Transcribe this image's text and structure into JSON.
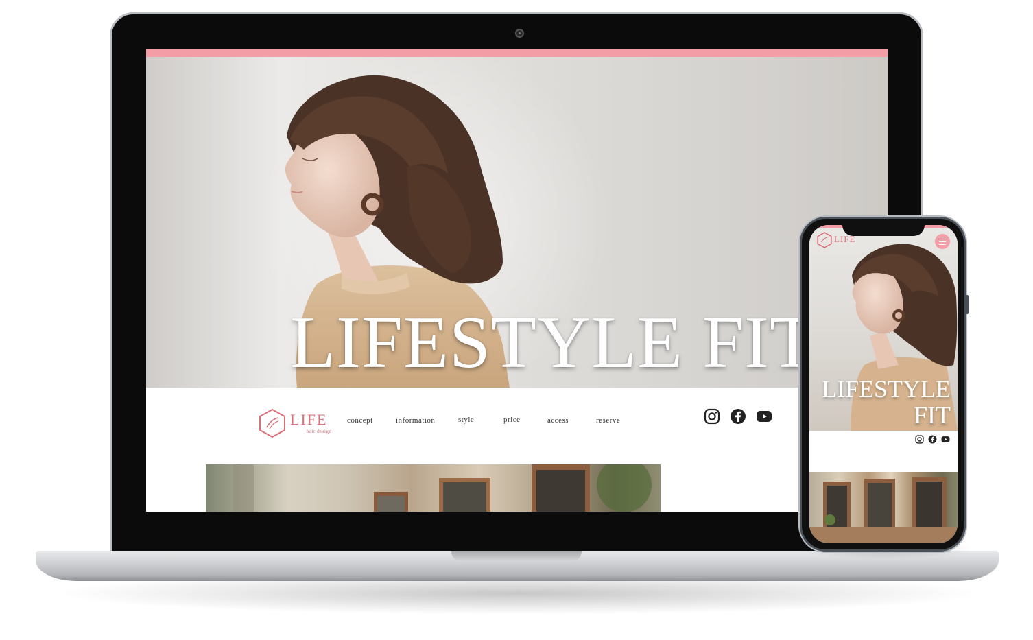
{
  "hero": {
    "title": "LIFESTYLE  FIT"
  },
  "brand": {
    "name": "LIFE",
    "tagline": "hair design",
    "accent_color": "#f39ea7",
    "logo_color": "#d9707a"
  },
  "nav": {
    "items": [
      {
        "label": "concept"
      },
      {
        "label": "information"
      },
      {
        "label": "style"
      },
      {
        "label": "price"
      },
      {
        "label": "access"
      },
      {
        "label": "reserve"
      }
    ]
  },
  "social": [
    {
      "icon": "instagram-icon"
    },
    {
      "icon": "facebook-icon"
    },
    {
      "icon": "youtube-icon"
    }
  ],
  "mobile": {
    "title_line1": "LIFESTYLE",
    "title_line2": "FIT",
    "menu_icon": "hamburger-menu-icon"
  }
}
